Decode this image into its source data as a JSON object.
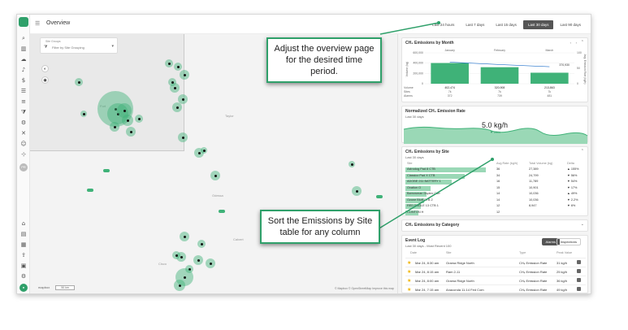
{
  "header": {
    "title": "Overview",
    "time_ranges": [
      "Last 24 hours",
      "Last 7 days",
      "Last 15 days",
      "Last 30 days",
      "Last 90 days"
    ],
    "active_range": "Last 30 days"
  },
  "map": {
    "site_groups_label": "Site Groups",
    "site_groups_placeholder": "Filter by Site Grouping",
    "labels": [
      "Odessa",
      "Taylor",
      "Calvert",
      "Cisco",
      "Fort"
    ],
    "attribution": "© Mapbox © OpenStreetMap Improve this map",
    "logo": "mapbox",
    "scale": "50 km"
  },
  "emissions_month": {
    "title": "CH₄ Emissions by Month",
    "months": [
      "January",
      "February",
      "March"
    ],
    "yaxis_left": "Volume (kg)",
    "yaxis_right": "Avg. Emission Rate (kg/h)",
    "left_ticks": [
      "600,000",
      "400,000",
      "200,000",
      "0"
    ],
    "right_ticks": [
      "100",
      "50",
      "0"
    ],
    "row_labels": [
      "Volume",
      "Sites",
      "Alarms"
    ],
    "volume": [
      "402,474",
      "320,908",
      "213,863"
    ],
    "sites": [
      "7k",
      "7k",
      "7k"
    ],
    "alarms": [
      "372",
      "739",
      "481"
    ],
    "annotation": "370,930",
    "chart_data": {
      "type": "bar",
      "categories": [
        "January",
        "February",
        "March"
      ],
      "values": [
        402474,
        320908,
        213863
      ],
      "ylim": [
        0,
        600000
      ],
      "line_values": [
        70,
        62,
        55
      ]
    }
  },
  "normalized": {
    "title": "Normalized CH₄ Emission Rate",
    "subtitle": "Last 30 days",
    "value": "5.0 kg/h",
    "change": "▼ 23%"
  },
  "by_site": {
    "title": "CH₄ Emissions by Site",
    "subtitle": "Last 30 days",
    "columns": [
      "Site",
      "Avg Rate (kg/h)",
      "Total Volume (kg)",
      "Delta"
    ],
    "rows": [
      {
        "site": "Astrodog Pad 8 CTB",
        "rate": "36",
        "volume": "27,389",
        "delta": "▲ 155%",
        "dir": "up",
        "fill": 0.95
      },
      {
        "site": "Classico Pad X CTB",
        "rate": "34",
        "volume": "24,799",
        "delta": "▼ 56%",
        "dir": "down",
        "fill": 0.7
      },
      {
        "site": "ADOBE 211 BATTERY 1",
        "rate": "16",
        "volume": "11,789",
        "delta": "▼ 54%",
        "dir": "down",
        "fill": 0.55
      },
      {
        "site": "Ovation O",
        "rate": "15",
        "volume": "10,901",
        "delta": "▼ 17%",
        "dir": "down",
        "fill": 0.3
      },
      {
        "site": "Barrowman Duplex Corr",
        "rate": "14",
        "volume": "10,036",
        "delta": "▲ 49%",
        "dir": "up",
        "fill": 0.25
      },
      {
        "site": "Ozone Bluff CTB 2",
        "rate": "14",
        "volume": "10,036",
        "delta": "▼ 2.2%",
        "dir": "down",
        "fill": 0.22
      },
      {
        "site": "RED EAGLE 13 CTB 1",
        "rate": "12",
        "volume": "8,947",
        "delta": "▼ 6%",
        "dir": "down",
        "fill": 0.18
      },
      {
        "site": "CLINTON H",
        "rate": "12",
        "volume": "",
        "delta": "",
        "dir": "down",
        "fill": 0.15
      }
    ]
  },
  "by_category": {
    "title": "CH₄ Emissions by Category"
  },
  "event_log": {
    "title": "Event Log",
    "subtitle": "Last 30 days - Most Recent 100",
    "tabs": [
      "Alarms",
      "Inspections"
    ],
    "columns": [
      "Date",
      "Site",
      "Type",
      "Peak Value"
    ],
    "rows": [
      {
        "date": "Mar 24, 8:30 am",
        "site": "Grama Ridge North",
        "type": "CH₄ Emission Rate",
        "value": "31 kg/h"
      },
      {
        "date": "Mar 24, 8:15 am",
        "site": "Ram 2-11",
        "type": "CH₄ Emission Rate",
        "value": "25 kg/h"
      },
      {
        "date": "Mar 24, 8:00 am",
        "site": "Grama Ridge North",
        "type": "CH₄ Emission Rate",
        "value": "36 kg/h"
      },
      {
        "date": "Mar 24, 7:15 am",
        "site": "Anaconda 11-14 Fed Com",
        "type": "CH₄ Emission Rate",
        "value": "49 kg/h"
      }
    ]
  },
  "callouts": {
    "top": "Adjust the overview page for the desired time period.",
    "bottom": "Sort the Emissions by Site table for any column"
  },
  "colors": {
    "accent": "#2fa06a",
    "bar": "#3fb278",
    "alert": "#d9534f"
  },
  "icons": [
    "search-icon",
    "chart-icon",
    "cloud-icon",
    "bell-icon",
    "coin-icon",
    "list-icon",
    "layers-icon",
    "filter-icon",
    "sliders-icon",
    "users-icon",
    "hierarchy-icon"
  ]
}
